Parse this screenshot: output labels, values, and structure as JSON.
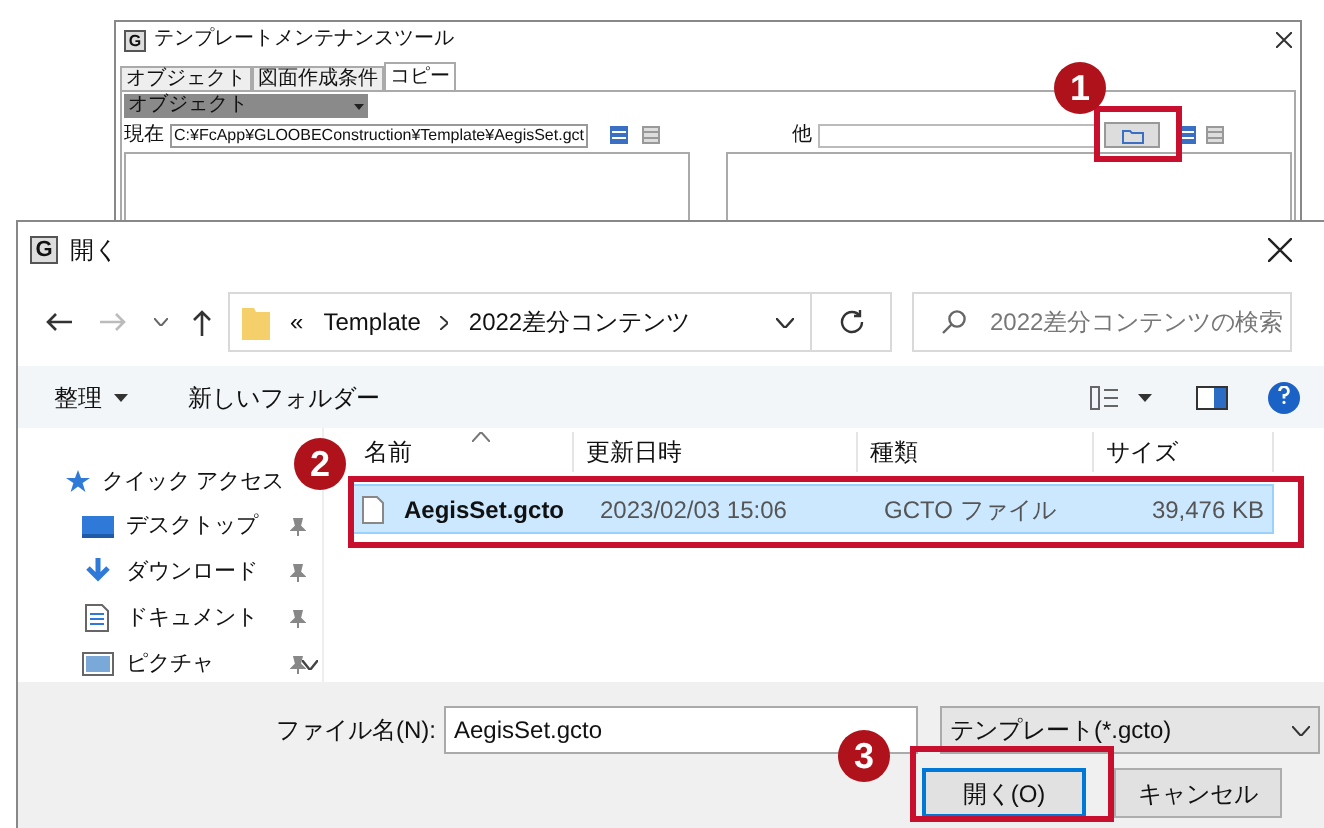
{
  "back_window": {
    "icon_letter": "G",
    "title": "テンプレートメンテナンスツール",
    "tabs": [
      {
        "label": "オブジェクト",
        "selected": false
      },
      {
        "label": "図面作成条件",
        "selected": false
      },
      {
        "label": "コピー",
        "selected": true
      }
    ],
    "category_dropdown": "オブジェクト",
    "current": {
      "label": "現在",
      "value": "C:¥FcApp¥GLOOBEConstruction¥Template¥AegisSet.gct"
    },
    "other": {
      "label": "他"
    }
  },
  "dialog": {
    "icon_letter": "G",
    "title": "開く",
    "address": {
      "overflow": "«",
      "crumbs": [
        "Template",
        "2022差分コンテンツ"
      ]
    },
    "search": {
      "placeholder": "2022差分コンテンツの検索"
    },
    "toolbar": {
      "organize": "整理",
      "new_folder": "新しいフォルダー"
    },
    "nav_items": [
      {
        "kind": "star",
        "label": "クイック アクセス",
        "pinned": false
      },
      {
        "kind": "desktop",
        "label": "デスクトップ",
        "pinned": true
      },
      {
        "kind": "download",
        "label": "ダウンロード",
        "pinned": true
      },
      {
        "kind": "document",
        "label": "ドキュメント",
        "pinned": true
      },
      {
        "kind": "picture",
        "label": "ピクチャ",
        "pinned": true
      }
    ],
    "columns": [
      "名前",
      "更新日時",
      "種類",
      "サイズ"
    ],
    "rows": [
      {
        "name": "AegisSet.gcto",
        "modified": "2023/02/03 15:06",
        "type": "GCTO ファイル",
        "size": "39,476 KB",
        "selected": true
      }
    ],
    "filename": {
      "label": "ファイル名(N):",
      "value": "AegisSet.gcto"
    },
    "filetype": "テンプレート(*.gcto)",
    "buttons": [
      {
        "kind": "primary",
        "label": "開く(O)"
      },
      {
        "kind": "secondary",
        "label": "キャンセル"
      }
    ]
  },
  "annotations": [
    {
      "number": "1"
    },
    {
      "number": "2"
    },
    {
      "number": "3"
    }
  ]
}
